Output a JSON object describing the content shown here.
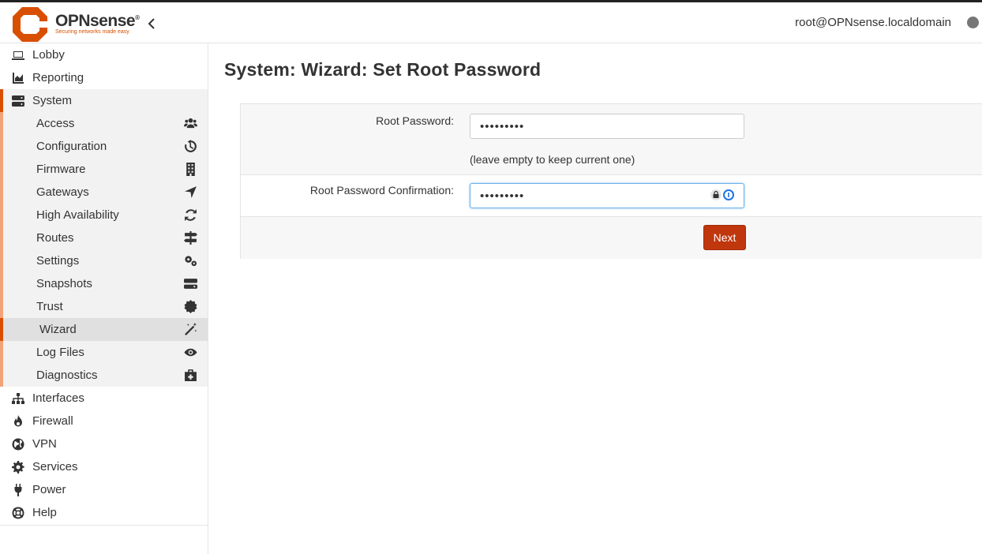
{
  "header": {
    "logo_name": "OPNsense",
    "logo_tagline": "Securing networks made easy",
    "collapse_icon": "chevron-left-icon",
    "user": "root@OPNsense.localdomain"
  },
  "sidebar": {
    "top_items": [
      {
        "label": "Lobby",
        "icon": "laptop-icon"
      },
      {
        "label": "Reporting",
        "icon": "chart-area-icon"
      }
    ],
    "system": {
      "label": "System",
      "icon": "server-icon",
      "items": [
        {
          "label": "Access",
          "icon": "users-icon"
        },
        {
          "label": "Configuration",
          "icon": "history-icon"
        },
        {
          "label": "Firmware",
          "icon": "building-icon"
        },
        {
          "label": "Gateways",
          "icon": "location-arrow-icon"
        },
        {
          "label": "High Availability",
          "icon": "refresh-icon"
        },
        {
          "label": "Routes",
          "icon": "signs-icon"
        },
        {
          "label": "Settings",
          "icon": "cogs-icon"
        },
        {
          "label": "Snapshots",
          "icon": "hdd-icon"
        },
        {
          "label": "Trust",
          "icon": "certificate-icon"
        },
        {
          "label": "Wizard",
          "icon": "magic-icon"
        },
        {
          "label": "Log Files",
          "icon": "eye-icon"
        },
        {
          "label": "Diagnostics",
          "icon": "medkit-icon"
        }
      ]
    },
    "bottom_items": [
      {
        "label": "Interfaces",
        "icon": "sitemap-icon"
      },
      {
        "label": "Firewall",
        "icon": "fire-icon"
      },
      {
        "label": "VPN",
        "icon": "globe-icon"
      },
      {
        "label": "Services",
        "icon": "cog-icon"
      },
      {
        "label": "Power",
        "icon": "plug-icon"
      },
      {
        "label": "Help",
        "icon": "life-ring-icon"
      }
    ]
  },
  "main": {
    "title": "System: Wizard: Set Root Password",
    "root_password_label": "Root Password:",
    "root_password_value": "•••••••••",
    "root_password_hint": "(leave empty to keep current one)",
    "confirm_label": "Root Password Confirmation:",
    "confirm_value": "•••••••••",
    "next_label": "Next"
  },
  "colors": {
    "brand": "#d94f00",
    "button": "#c0360d"
  }
}
